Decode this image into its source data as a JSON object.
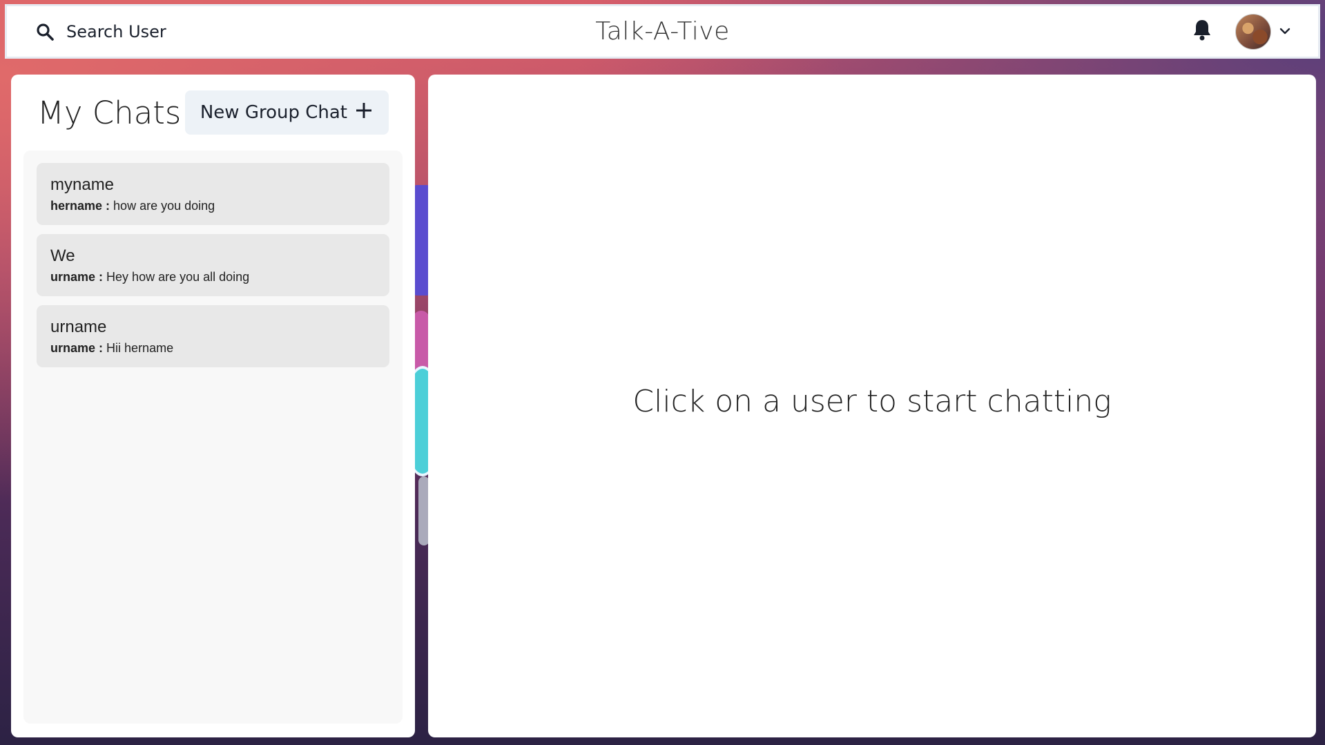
{
  "header": {
    "search_label": "Search User",
    "app_title": "Talk-A-Tive",
    "icons": {
      "search": "search-icon",
      "bell": "bell-icon",
      "chevron": "chevron-down-icon"
    }
  },
  "chats_panel": {
    "title": "My Chats",
    "new_group_label": "New Group Chat",
    "chats": [
      {
        "name": "myname",
        "sender": "hername :",
        "message": "how are you doing"
      },
      {
        "name": "We",
        "sender": "urname :",
        "message": "Hey how are you all doing"
      },
      {
        "name": "urname",
        "sender": "urname :",
        "message": "Hii hername"
      }
    ]
  },
  "main": {
    "empty_message": "Click on a user to start chatting"
  },
  "colors": {
    "panel_bg": "#ffffff",
    "chat_item_bg": "#e8e8e8",
    "button_bg": "#edf2f7"
  }
}
